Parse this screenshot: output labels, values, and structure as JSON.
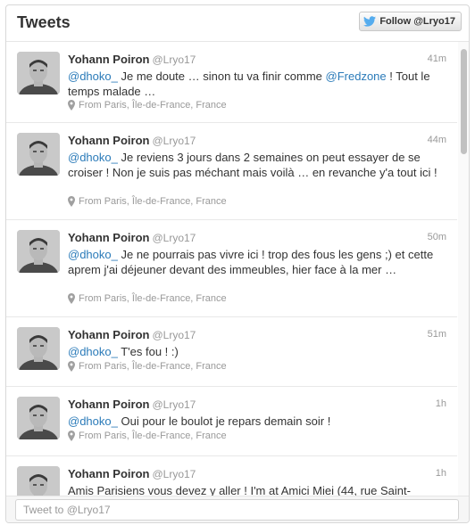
{
  "header": {
    "title": "Tweets",
    "follow_label": "Follow @Lryo17"
  },
  "tweets": [
    {
      "name": "Yohann Poiron",
      "handle": "@Lryo17",
      "time": "41m",
      "segments": [
        {
          "t": "@dhoko_",
          "mention": true
        },
        {
          "t": " Je me doute … sinon tu va finir comme "
        },
        {
          "t": "@Fredzone",
          "mention": true
        },
        {
          "t": " ! Tout le temps malade …"
        }
      ],
      "location": "From Paris, Île-de-France, France"
    },
    {
      "name": "Yohann Poiron",
      "handle": "@Lryo17",
      "time": "44m",
      "segments": [
        {
          "t": "@dhoko_",
          "mention": true
        },
        {
          "t": " Je reviens 3 jours dans 2 semaines on peut essayer de se croiser ! Non je suis pas méchant mais voilà … en revanche y'a tout ici !"
        }
      ],
      "location": "From Paris, Île-de-France, France"
    },
    {
      "name": "Yohann Poiron",
      "handle": "@Lryo17",
      "time": "50m",
      "segments": [
        {
          "t": "@dhoko_",
          "mention": true
        },
        {
          "t": " Je ne pourrais pas vivre ici ! trop des fous les gens ;) et cette aprem j'ai déjeuner devant des immeubles, hier face à la mer …"
        }
      ],
      "location": "From Paris, Île-de-France, France"
    },
    {
      "name": "Yohann Poiron",
      "handle": "@Lryo17",
      "time": "51m",
      "segments": [
        {
          "t": "@dhoko_",
          "mention": true
        },
        {
          "t": " T'es fou ! :)"
        }
      ],
      "location": "From Paris, Île-de-France, France"
    },
    {
      "name": "Yohann Poiron",
      "handle": "@Lryo17",
      "time": "1h",
      "segments": [
        {
          "t": "@dhoko_",
          "mention": true
        },
        {
          "t": " Oui pour le boulot je repars demain soir !"
        }
      ],
      "location": "From Paris, Île-de-France, France"
    },
    {
      "name": "Yohann Poiron",
      "handle": "@Lryo17",
      "time": "1h",
      "segments": [
        {
          "t": "Amis Parisiens vous devez y aller ! I'm at Amici Miei (44, rue Saint-"
        }
      ],
      "location": ""
    }
  ],
  "reply": {
    "placeholder": "Tweet to @Lryo17"
  },
  "colors": {
    "mention": "#2b7bb9",
    "twitter_bird": "#55acee"
  }
}
